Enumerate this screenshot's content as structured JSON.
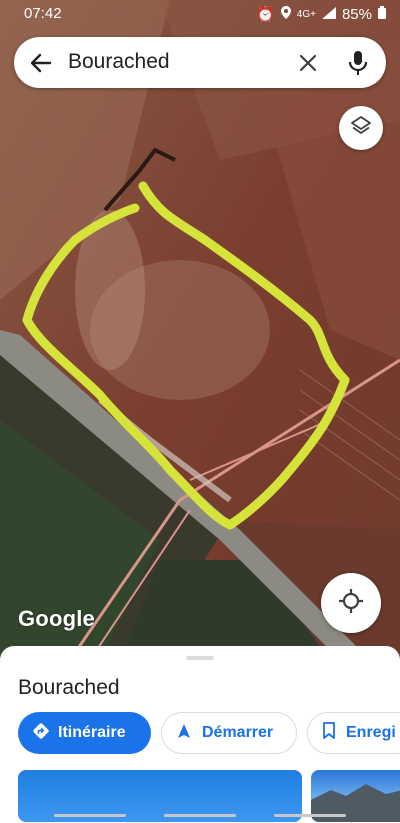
{
  "status_bar": {
    "time": "07:42",
    "network": "4G+",
    "battery": "85%"
  },
  "search": {
    "query": "Bourached"
  },
  "map": {
    "attribution": "Google",
    "outline_color": "#d6e33a"
  },
  "sheet": {
    "place_name": "Bourached",
    "buttons": {
      "directions": "Itinéraire",
      "start": "Démarrer",
      "save": "Enregi"
    }
  },
  "colors": {
    "accent": "#1a73e8"
  }
}
